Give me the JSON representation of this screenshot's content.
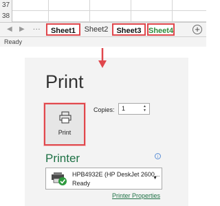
{
  "grid": {
    "rows": [
      "37",
      "38"
    ]
  },
  "sheet_tabs": {
    "tabs": [
      {
        "label": "Sheet1",
        "style": "highlighted-bold"
      },
      {
        "label": "Sheet2",
        "style": "plain"
      },
      {
        "label": "Sheet3",
        "style": "highlighted-bold"
      },
      {
        "label": "Sheet4",
        "style": "highlighted-green"
      }
    ],
    "ellipsis": "...",
    "add_symbol": "+"
  },
  "status_bar": {
    "text": "Ready"
  },
  "print_panel": {
    "title": "Print",
    "print_button_label": "Print",
    "copies_label": "Copies:",
    "copies_value": "1",
    "printer_heading": "Printer",
    "info_symbol": "i",
    "printer_name": "HPB4932E (HP DeskJet 2600...",
    "printer_status": "Ready",
    "printer_properties_link": "Printer Properties"
  },
  "colors": {
    "highlight": "#e0474c",
    "excel_green": "#1e7145",
    "panel_bg": "#f3f3f3"
  },
  "icons": [
    "nav-left-icon",
    "nav-right-icon",
    "add-sheet-icon",
    "down-arrow-icon",
    "printer-icon",
    "info-icon",
    "printer-ready-icon",
    "dropdown-caret-icon"
  ]
}
